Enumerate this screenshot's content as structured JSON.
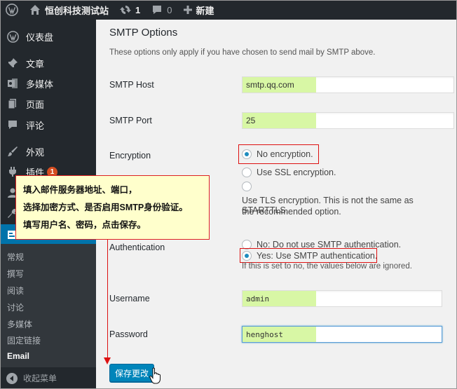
{
  "adminbar": {
    "site_name": "恒创科技测试站",
    "updates_count": "1",
    "comments_count": "0",
    "new_label": "新建"
  },
  "sidebar": {
    "items": [
      {
        "label": "仪表盘",
        "icon": "dashboard-icon"
      },
      {
        "label": "文章",
        "icon": "pin-icon"
      },
      {
        "label": "多媒体",
        "icon": "media-icon"
      },
      {
        "label": "页面",
        "icon": "page-icon"
      },
      {
        "label": "评论",
        "icon": "comment-icon"
      },
      {
        "label": "外观",
        "icon": "brush-icon"
      },
      {
        "label": "插件",
        "icon": "plugin-icon",
        "badge": "1"
      }
    ],
    "submenu": [
      "常规",
      "撰写",
      "阅读",
      "讨论",
      "多媒体",
      "固定链接",
      "Email"
    ],
    "collapse_label": "收起菜单"
  },
  "main": {
    "title": "SMTP Options",
    "description": "These options only apply if you have chosen to send mail by SMTP above.",
    "smtp_host": {
      "label": "SMTP Host",
      "value": "smtp.qq.com"
    },
    "smtp_port": {
      "label": "SMTP Port",
      "value": "25"
    },
    "encryption": {
      "label": "Encryption",
      "options": [
        "No encryption.",
        "Use SSL encryption."
      ],
      "tls_line1": "Use TLS encryption. This is not the same as STARTTLS.",
      "tls_line2": "the recommended option.",
      "selected": 0
    },
    "authentication": {
      "label": "Authentication",
      "options": [
        "No: Do not use SMTP authentication.",
        "Yes: Use SMTP authentication."
      ],
      "note": "If this is set to no, the values below are ignored.",
      "selected": 1
    },
    "username": {
      "label": "Username",
      "value": "admin"
    },
    "password": {
      "label": "Password",
      "value": "henghost"
    },
    "save_label": "保存更改"
  },
  "callout": {
    "line1": "填入邮件服务器地址、端口，",
    "line2": "选择加密方式、是否启用SMTP身份验证。",
    "line3": "填写用户名、密码，点击保存。"
  },
  "colors": {
    "accent": "#0073aa",
    "highlight": "#d8f7a5",
    "annotation_red": "#dd1111",
    "callout_bg": "#ffffcc"
  }
}
